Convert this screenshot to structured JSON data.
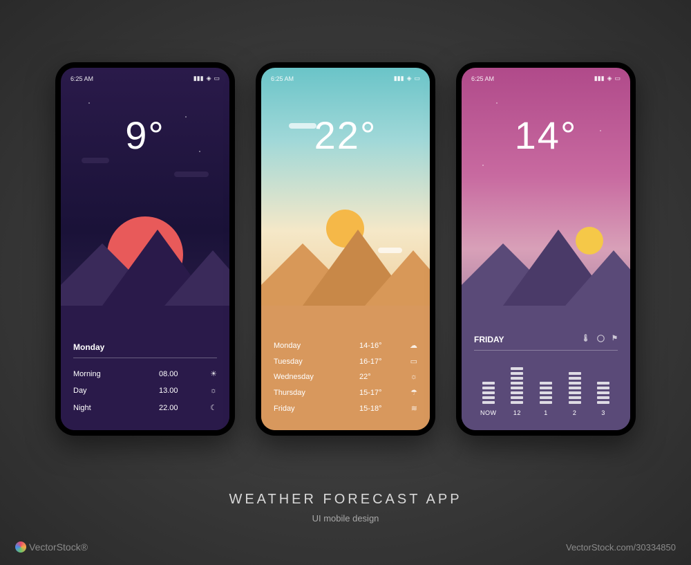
{
  "status_time": "6:25 AM",
  "phones": [
    {
      "temp": "9°",
      "header": "Monday",
      "rows": [
        {
          "label": "Morning",
          "value": "08.00",
          "icon": "☀"
        },
        {
          "label": "Day",
          "value": "13.00",
          "icon": "☼"
        },
        {
          "label": "Night",
          "value": "22.00",
          "icon": "☾"
        }
      ]
    },
    {
      "temp": "22°",
      "rows": [
        {
          "label": "Monday",
          "value": "14-16°",
          "icon": "☁"
        },
        {
          "label": "Tuesday",
          "value": "16-17°",
          "icon": "▭"
        },
        {
          "label": "Wednesday",
          "value": "22°",
          "icon": "☼"
        },
        {
          "label": "Thursday",
          "value": "15-17°",
          "icon": "☂"
        },
        {
          "label": "Friday",
          "value": "15-18°",
          "icon": "≋"
        }
      ]
    },
    {
      "temp": "14°",
      "header": "FRIDAY",
      "hourly": [
        {
          "label": "NOW",
          "bars": 5
        },
        {
          "label": "12",
          "bars": 8
        },
        {
          "label": "1",
          "bars": 5
        },
        {
          "label": "2",
          "bars": 7
        },
        {
          "label": "3",
          "bars": 5
        }
      ]
    }
  ],
  "footer": {
    "title": "WEATHER FORECAST APP",
    "subtitle": "UI mobile design"
  },
  "watermark_left": "VectorStock®",
  "watermark_right": "VectorStock.com/30334850"
}
